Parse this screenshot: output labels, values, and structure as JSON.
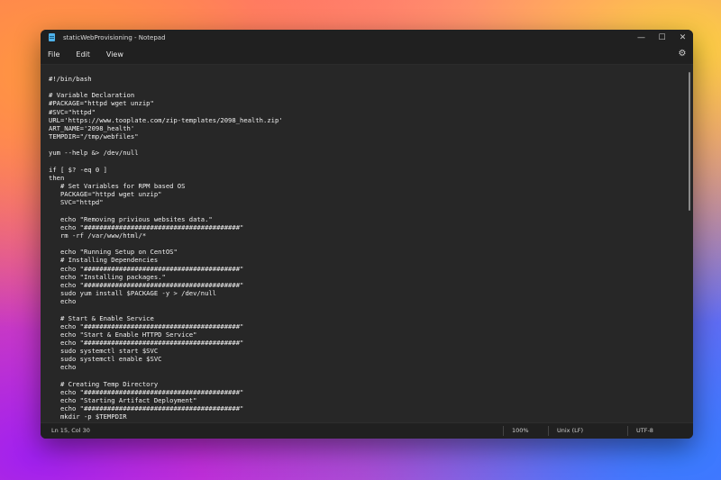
{
  "window": {
    "title": "staticWebProvisioning - Notepad",
    "controls": {
      "minimize": "—",
      "maximize": "☐",
      "close": "✕"
    }
  },
  "menu": {
    "file": "File",
    "edit": "Edit",
    "view": "View",
    "settings_icon": "gear-icon"
  },
  "editor": {
    "content": "#!/bin/bash\n\n# Variable Declaration\n#PACKAGE=\"httpd wget unzip\"\n#SVC=\"httpd\"\nURL='https://www.tooplate.com/zip-templates/2098_health.zip'\nART_NAME='2098_health'\nTEMPDIR=\"/tmp/webfiles\"\n\nyum --help &> /dev/null\n\nif [ $? -eq 0 ]\nthen\n   # Set Variables for RPM based OS\n   PACKAGE=\"httpd wget unzip\"\n   SVC=\"httpd\"\n\n   echo \"Removing privious websites data.\"\n   echo \"########################################\"\n   rm -rf /var/www/html/*\n\n   echo \"Running Setup on CentOS\"\n   # Installing Dependencies\n   echo \"########################################\"\n   echo \"Installing packages.\"\n   echo \"########################################\"\n   sudo yum install $PACKAGE -y > /dev/null\n   echo\n\n   # Start & Enable Service\n   echo \"########################################\"\n   echo \"Start & Enable HTTPD Service\"\n   echo \"########################################\"\n   sudo systemctl start $SVC\n   sudo systemctl enable $SVC\n   echo\n\n   # Creating Temp Directory\n   echo \"########################################\"\n   echo \"Starting Artifact Deployment\"\n   echo \"########################################\"\n   mkdir -p $TEMPDIR"
  },
  "status": {
    "position": "Ln 15, Col 30",
    "zoom": "100%",
    "line_endings": "Unix (LF)",
    "encoding": "UTF-8"
  }
}
